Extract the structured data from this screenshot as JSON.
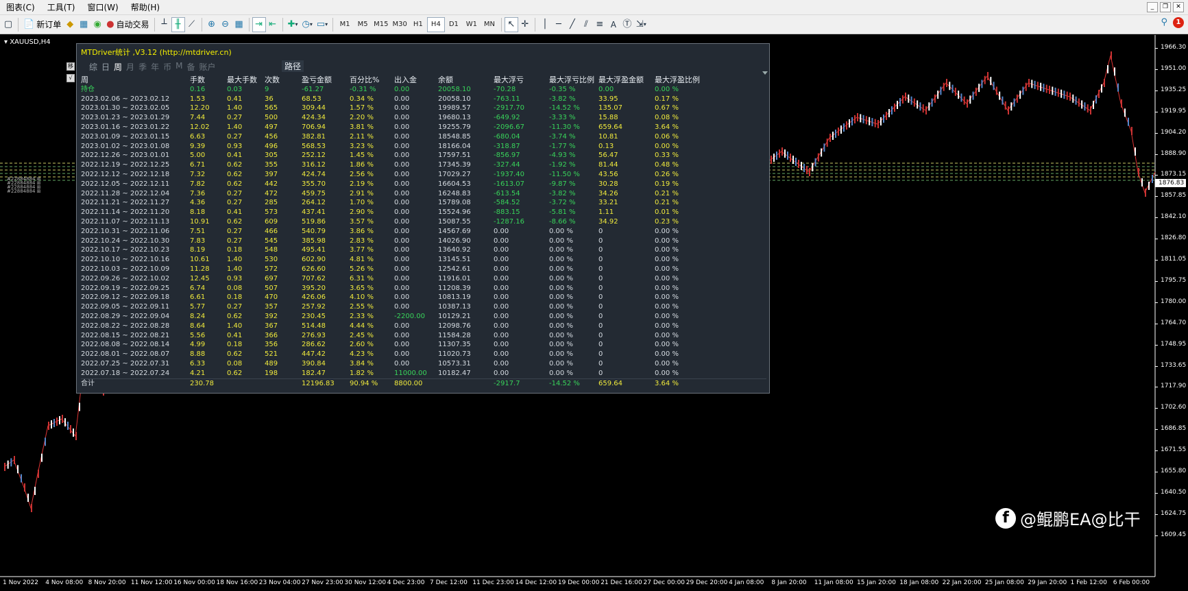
{
  "menu": {
    "items": [
      "图表(C)",
      "工具(T)",
      "窗口(W)",
      "帮助(H)"
    ]
  },
  "toolbar": {
    "new_order": "新订单",
    "auto_trade": "自动交易",
    "timeframes": [
      "M1",
      "M5",
      "M15",
      "M30",
      "H1",
      "H4",
      "D1",
      "W1",
      "MN"
    ],
    "active_timeframe": "H4",
    "text_tool": "A",
    "notifications": "1"
  },
  "chart": {
    "symbol": "XAUUSD,H4",
    "current_price": "1876.83",
    "price_ticks": [
      "1966.30",
      "1951.00",
      "1935.25",
      "1919.95",
      "1904.20",
      "1888.90",
      "1873.15",
      "1857.85",
      "1842.10",
      "1826.80",
      "1811.05",
      "1795.75",
      "1780.00",
      "1764.70",
      "1748.95",
      "1733.65",
      "1717.90",
      "1702.60",
      "1686.85",
      "1671.55",
      "1655.80",
      "1640.50",
      "1624.75",
      "1609.45"
    ],
    "time_ticks": [
      "1 Nov 2022",
      "4 Nov 08:00",
      "8 Nov 20:00",
      "11 Nov 12:00",
      "16 Nov 00:00",
      "18 Nov 16:00",
      "23 Nov 04:00",
      "27 Nov 23:00",
      "30 Nov 12:00",
      "4 Dec 23:00",
      "7 Dec 12:00",
      "11 Dec 23:00",
      "14 Dec 12:00",
      "19 Dec 00:00",
      "21 Dec 16:00",
      "27 Dec 00:00",
      "29 Dec 20:00",
      "4 Jan 08:00",
      "8 Jan 20:00",
      "11 Jan 08:00",
      "15 Jan 20:00",
      "18 Jan 08:00",
      "22 Jan 20:00",
      "25 Jan 08:00",
      "29 Jan 20:00",
      "1 Feb 12:00",
      "6 Feb 00:00"
    ]
  },
  "watermark": {
    "text": "@鲲鹏EA@比干",
    "logo": "f"
  },
  "panel": {
    "title": "MTDriver统计 ,V3.12 (http://mtdriver.cn)",
    "tabs": [
      "综",
      "日",
      "周",
      "月",
      "季",
      "年",
      "币",
      "M",
      "备",
      "账户"
    ],
    "active_tab": "周",
    "path_button": "路径",
    "side_buttons": [
      "移",
      "√"
    ],
    "headers": [
      "周",
      "手数",
      "最大手数",
      "次数",
      "盈亏金额",
      "百分比%",
      "出入金",
      "余额",
      "最大浮亏",
      "最大浮亏比例",
      "最大浮盈金额",
      "最大浮盈比例"
    ],
    "position_row": [
      "持仓",
      "0.16",
      "0.03",
      "9",
      "-61.27",
      "-0.31 %",
      "0.00",
      "20058.10",
      "-70.28",
      "-0.35 %",
      "0.00",
      "0.00 %"
    ],
    "rows": [
      [
        "2023.02.06 ~ 2023.02.12",
        "1.53",
        "0.41",
        "36",
        "68.53",
        "0.34 %",
        "0.00",
        "20058.10",
        "-763.11",
        "-3.82 %",
        "33.95",
        "0.17 %"
      ],
      [
        "2023.01.30 ~ 2023.02.05",
        "12.20",
        "1.40",
        "565",
        "309.44",
        "1.57 %",
        "0.00",
        "19989.57",
        "-2917.70",
        "-14.52 %",
        "135.07",
        "0.67 %"
      ],
      [
        "2023.01.23 ~ 2023.01.29",
        "7.44",
        "0.27",
        "500",
        "424.34",
        "2.20 %",
        "0.00",
        "19680.13",
        "-649.92",
        "-3.33 %",
        "15.88",
        "0.08 %"
      ],
      [
        "2023.01.16 ~ 2023.01.22",
        "12.02",
        "1.40",
        "497",
        "706.94",
        "3.81 %",
        "0.00",
        "19255.79",
        "-2096.67",
        "-11.30 %",
        "659.64",
        "3.64 %"
      ],
      [
        "2023.01.09 ~ 2023.01.15",
        "6.63",
        "0.27",
        "456",
        "382.81",
        "2.11 %",
        "0.00",
        "18548.85",
        "-680.04",
        "-3.74 %",
        "10.81",
        "0.06 %"
      ],
      [
        "2023.01.02 ~ 2023.01.08",
        "9.39",
        "0.93",
        "496",
        "568.53",
        "3.23 %",
        "0.00",
        "18166.04",
        "-318.87",
        "-1.77 %",
        "0.13",
        "0.00 %"
      ],
      [
        "2022.12.26 ~ 2023.01.01",
        "5.00",
        "0.41",
        "305",
        "252.12",
        "1.45 %",
        "0.00",
        "17597.51",
        "-856.97",
        "-4.93 %",
        "56.47",
        "0.33 %"
      ],
      [
        "2022.12.19 ~ 2022.12.25",
        "6.71",
        "0.62",
        "355",
        "316.12",
        "1.86 %",
        "0.00",
        "17345.39",
        "-327.44",
        "-1.92 %",
        "81.44",
        "0.48 %"
      ],
      [
        "2022.12.12 ~ 2022.12.18",
        "7.32",
        "0.62",
        "397",
        "424.74",
        "2.56 %",
        "0.00",
        "17029.27",
        "-1937.40",
        "-11.50 %",
        "43.56",
        "0.26 %"
      ],
      [
        "2022.12.05 ~ 2022.12.11",
        "7.82",
        "0.62",
        "442",
        "355.70",
        "2.19 %",
        "0.00",
        "16604.53",
        "-1613.07",
        "-9.87 %",
        "30.28",
        "0.19 %"
      ],
      [
        "2022.11.28 ~ 2022.12.04",
        "7.36",
        "0.27",
        "472",
        "459.75",
        "2.91 %",
        "0.00",
        "16248.83",
        "-613.54",
        "-3.82 %",
        "34.26",
        "0.21 %"
      ],
      [
        "2022.11.21 ~ 2022.11.27",
        "4.36",
        "0.27",
        "285",
        "264.12",
        "1.70 %",
        "0.00",
        "15789.08",
        "-584.52",
        "-3.72 %",
        "33.21",
        "0.21 %"
      ],
      [
        "2022.11.14 ~ 2022.11.20",
        "8.18",
        "0.41",
        "573",
        "437.41",
        "2.90 %",
        "0.00",
        "15524.96",
        "-883.15",
        "-5.81 %",
        "1.11",
        "0.01 %"
      ],
      [
        "2022.11.07 ~ 2022.11.13",
        "10.91",
        "0.62",
        "609",
        "519.86",
        "3.57 %",
        "0.00",
        "15087.55",
        "-1287.16",
        "-8.66 %",
        "34.92",
        "0.23 %"
      ],
      [
        "2022.10.31 ~ 2022.11.06",
        "7.51",
        "0.27",
        "466",
        "540.79",
        "3.86 %",
        "0.00",
        "14567.69",
        "0.00",
        "0.00 %",
        "0",
        "0.00 %"
      ],
      [
        "2022.10.24 ~ 2022.10.30",
        "7.83",
        "0.27",
        "545",
        "385.98",
        "2.83 %",
        "0.00",
        "14026.90",
        "0.00",
        "0.00 %",
        "0",
        "0.00 %"
      ],
      [
        "2022.10.17 ~ 2022.10.23",
        "8.19",
        "0.18",
        "548",
        "495.41",
        "3.77 %",
        "0.00",
        "13640.92",
        "0.00",
        "0.00 %",
        "0",
        "0.00 %"
      ],
      [
        "2022.10.10 ~ 2022.10.16",
        "10.61",
        "1.40",
        "530",
        "602.90",
        "4.81 %",
        "0.00",
        "13145.51",
        "0.00",
        "0.00 %",
        "0",
        "0.00 %"
      ],
      [
        "2022.10.03 ~ 2022.10.09",
        "11.28",
        "1.40",
        "572",
        "626.60",
        "5.26 %",
        "0.00",
        "12542.61",
        "0.00",
        "0.00 %",
        "0",
        "0.00 %"
      ],
      [
        "2022.09.26 ~ 2022.10.02",
        "12.45",
        "0.93",
        "697",
        "707.62",
        "6.31 %",
        "0.00",
        "11916.01",
        "0.00",
        "0.00 %",
        "0",
        "0.00 %"
      ],
      [
        "2022.09.19 ~ 2022.09.25",
        "6.74",
        "0.08",
        "507",
        "395.20",
        "3.65 %",
        "0.00",
        "11208.39",
        "0.00",
        "0.00 %",
        "0",
        "0.00 %"
      ],
      [
        "2022.09.12 ~ 2022.09.18",
        "6.61",
        "0.18",
        "470",
        "426.06",
        "4.10 %",
        "0.00",
        "10813.19",
        "0.00",
        "0.00 %",
        "0",
        "0.00 %"
      ],
      [
        "2022.09.05 ~ 2022.09.11",
        "5.77",
        "0.27",
        "357",
        "257.92",
        "2.55 %",
        "0.00",
        "10387.13",
        "0.00",
        "0.00 %",
        "0",
        "0.00 %"
      ],
      [
        "2022.08.29 ~ 2022.09.04",
        "8.24",
        "0.62",
        "392",
        "230.45",
        "2.33 %",
        "-2200.00",
        "10129.21",
        "0.00",
        "0.00 %",
        "0",
        "0.00 %"
      ],
      [
        "2022.08.22 ~ 2022.08.28",
        "8.64",
        "1.40",
        "367",
        "514.48",
        "4.44 %",
        "0.00",
        "12098.76",
        "0.00",
        "0.00 %",
        "0",
        "0.00 %"
      ],
      [
        "2022.08.15 ~ 2022.08.21",
        "5.56",
        "0.41",
        "366",
        "276.93",
        "2.45 %",
        "0.00",
        "11584.28",
        "0.00",
        "0.00 %",
        "0",
        "0.00 %"
      ],
      [
        "2022.08.08 ~ 2022.08.14",
        "4.99",
        "0.18",
        "356",
        "286.62",
        "2.60 %",
        "0.00",
        "11307.35",
        "0.00",
        "0.00 %",
        "0",
        "0.00 %"
      ],
      [
        "2022.08.01 ~ 2022.08.07",
        "8.88",
        "0.62",
        "521",
        "447.42",
        "4.23 %",
        "0.00",
        "11020.73",
        "0.00",
        "0.00 %",
        "0",
        "0.00 %"
      ],
      [
        "2022.07.25 ~ 2022.07.31",
        "6.33",
        "0.08",
        "489",
        "390.84",
        "3.84 %",
        "0.00",
        "10573.31",
        "0.00",
        "0.00 %",
        "0",
        "0.00 %"
      ],
      [
        "2022.07.18 ~ 2022.07.24",
        "4.21",
        "0.62",
        "198",
        "182.47",
        "1.82 %",
        "11000.00",
        "10182.47",
        "0.00",
        "0.00 %",
        "0",
        "0.00 %"
      ]
    ],
    "total_row": [
      "合计",
      "230.78",
      "",
      "",
      "12196.83",
      "90.94 %",
      "8800.00",
      "",
      "-2917.7",
      "-14.52 %",
      "659.64",
      "3.64 %"
    ]
  },
  "colors": {
    "panel_bg": "#232a33",
    "yellow": "#f0ea3c",
    "green": "#38d45a",
    "chart_bg": "#000000"
  }
}
